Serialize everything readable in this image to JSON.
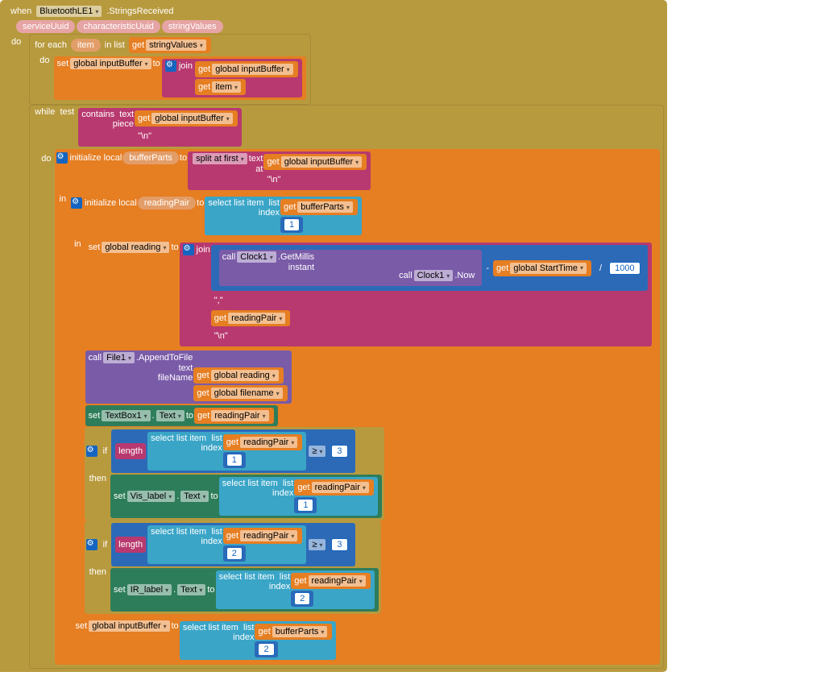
{
  "event": {
    "when": "when",
    "component": "BluetoothLE1",
    "method": ".StringsReceived",
    "params": [
      "serviceUuid",
      "characteristicUuid",
      "stringValues"
    ],
    "do": "do"
  },
  "foreach": {
    "label": "for each",
    "var": "item",
    "inlist": "in list",
    "do": "do"
  },
  "kw": {
    "get": "get",
    "set": "set",
    "to": "to",
    "join": "join",
    "while": "while",
    "test": "test",
    "contains": "contains",
    "text": "text",
    "piece": "piece",
    "initlocal": "initialize local",
    "in": "in",
    "splitfirst": "split at first",
    "at": "at",
    "selectitem": "select list item",
    "list": "list",
    "index": "index",
    "call": "call",
    "if": "if",
    "then": "then",
    "length": "length"
  },
  "vars": {
    "stringValues": "stringValues",
    "inputBuffer": "global inputBuffer",
    "item": "item",
    "bufferParts": "bufferParts",
    "readingPair": "readingPair",
    "reading": "global reading",
    "StartTime": "global StartTime",
    "filename": "global filename"
  },
  "lits": {
    "newline": "\\n",
    "comma": ",",
    "n1": "1",
    "n2": "2",
    "n3": "3",
    "n1000": "1000",
    "minus": "-",
    "div": "/"
  },
  "comp": {
    "Clock1": "Clock1",
    "GetMillis": ".GetMillis",
    "instant": "instant",
    "Now": ".Now",
    "File1": "File1",
    "AppendToFile": ".AppendToFile",
    "fileName": "fileName",
    "TextBox1": "TextBox1",
    "Text": "Text",
    "Vis_label": "Vis_label",
    "IR_label": "IR_label"
  },
  "ops": {
    "gte": "≥"
  }
}
